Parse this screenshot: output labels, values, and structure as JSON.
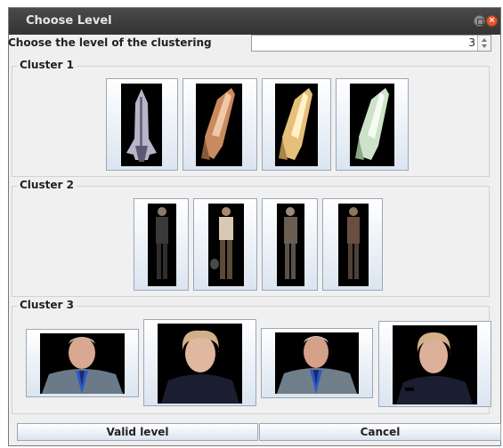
{
  "window": {
    "title": "Choose Level"
  },
  "level": {
    "label": "Choose the level of the clustering",
    "value": "3"
  },
  "clusters": [
    {
      "label": "Cluster 1"
    },
    {
      "label": "Cluster 2"
    },
    {
      "label": "Cluster 3"
    }
  ],
  "buttons": {
    "valid": "Valid level",
    "cancel": "Cancel"
  }
}
